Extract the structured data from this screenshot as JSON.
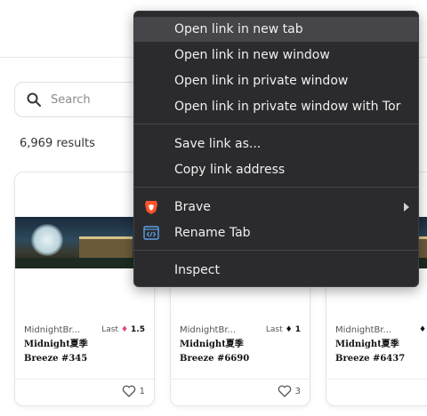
{
  "search": {
    "placeholder": "Search"
  },
  "results": {
    "count_text": "6,969 results"
  },
  "cards": [
    {
      "collection": "MidnightBr...",
      "last_label": "Last",
      "price": "1.5",
      "eth_icon": "eth-icon",
      "eth_color": "#e0457b",
      "title_line1": "Midnight夏季",
      "title_line2": "Breeze #345",
      "likes": "1"
    },
    {
      "collection": "MidnightBr...",
      "last_label": "Last",
      "price": "1",
      "eth_icon": "eth-icon",
      "eth_color": "#111111",
      "title_line1": "Midnight夏季",
      "title_line2": "Breeze #6690",
      "likes": "3"
    },
    {
      "collection": "MidnightBr...",
      "last_label": "",
      "price": "",
      "eth_icon": "eth-icon",
      "eth_color": "#111111",
      "title_line1": "Midnight夏季",
      "title_line2": "Breeze #6437",
      "likes": ""
    }
  ],
  "context_menu": {
    "items": [
      {
        "label": "Open link in new tab"
      },
      {
        "label": "Open link in new window"
      },
      {
        "label": "Open link in private window"
      },
      {
        "label": "Open link in private window with Tor"
      },
      {
        "label": "Save link as..."
      },
      {
        "label": "Copy link address"
      },
      {
        "label": "Brave",
        "icon": "brave-lion-icon",
        "submenu": true
      },
      {
        "label": "Rename Tab",
        "icon": "code-tab-icon"
      },
      {
        "label": "Inspect"
      }
    ]
  },
  "colors": {
    "menu_bg": "#2b2b2e",
    "menu_hover": "#45454a",
    "brave_orange": "#fb542b",
    "rename_blue": "#5aa0e6"
  }
}
